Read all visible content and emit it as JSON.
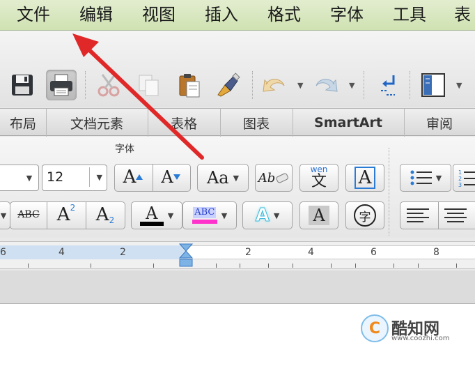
{
  "menu": {
    "items": [
      "文件",
      "编辑",
      "视图",
      "插入",
      "格式",
      "字体",
      "工具",
      "表"
    ]
  },
  "ribbon": {
    "tabs": [
      "布局",
      "文档元素",
      "表格",
      "图表",
      "SmartArt",
      "审阅"
    ],
    "group_label": "字体",
    "font_size_value": "12",
    "superscript_label": "A",
    "superscript_mark": "2",
    "subscript_label": "A",
    "subscript_mark": "2",
    "strikethrough_label": "ABC",
    "highlight_label": "ABC",
    "phonetic_top": "wen",
    "phonetic_char": "文",
    "enclose_char": "字",
    "grow_label": "A",
    "shrink_label": "A",
    "change_case_label": "Aa",
    "clear_format_label": "Ab",
    "border_char_label": "A",
    "font_color_label": "A",
    "text_effect_label": "A",
    "shade_label": "A",
    "font_color_hex": "#000000",
    "highlight_hex": "#ff33cc"
  },
  "ruler": {
    "labels": [
      "6",
      "4",
      "2",
      "2",
      "4",
      "6",
      "8"
    ]
  },
  "watermark": {
    "name": "酷知网",
    "url": "www.coozhi.com"
  },
  "annotation": {
    "arrow_color": "#e02828"
  },
  "icons": {
    "save": "save-icon",
    "print": "printer-icon",
    "cut": "scissors-icon",
    "copy": "copy-icon",
    "paste": "paste-icon",
    "format_painter": "brush-icon",
    "undo": "undo-icon",
    "redo": "redo-icon",
    "show_marks": "paragraph-mark-icon",
    "sidebar": "sidebar-icon"
  }
}
